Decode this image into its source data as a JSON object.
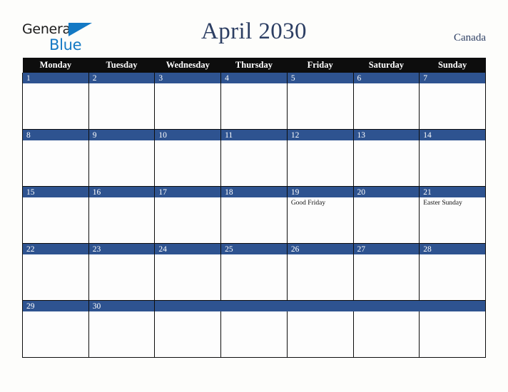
{
  "brand": {
    "name_part1": "General",
    "name_part2": "Blue",
    "triangle_icon": "triangle-icon",
    "color_primary": "#1479c4",
    "color_text": "#1b1b1b"
  },
  "header": {
    "title": "April 2030",
    "region": "Canada",
    "title_color": "#2c3e63"
  },
  "calendar": {
    "weekday_headers": [
      "Monday",
      "Tuesday",
      "Wednesday",
      "Thursday",
      "Friday",
      "Saturday",
      "Sunday"
    ],
    "header_bg": "#0d0d0d",
    "date_band_bg": "#2e5390",
    "cell_bg": "#fdfdfd",
    "weeks": [
      {
        "days": [
          {
            "date": "1",
            "events": []
          },
          {
            "date": "2",
            "events": []
          },
          {
            "date": "3",
            "events": []
          },
          {
            "date": "4",
            "events": []
          },
          {
            "date": "5",
            "events": []
          },
          {
            "date": "6",
            "events": []
          },
          {
            "date": "7",
            "events": []
          }
        ]
      },
      {
        "days": [
          {
            "date": "8",
            "events": []
          },
          {
            "date": "9",
            "events": []
          },
          {
            "date": "10",
            "events": []
          },
          {
            "date": "11",
            "events": []
          },
          {
            "date": "12",
            "events": []
          },
          {
            "date": "13",
            "events": []
          },
          {
            "date": "14",
            "events": []
          }
        ]
      },
      {
        "days": [
          {
            "date": "15",
            "events": []
          },
          {
            "date": "16",
            "events": []
          },
          {
            "date": "17",
            "events": []
          },
          {
            "date": "18",
            "events": []
          },
          {
            "date": "19",
            "events": [
              "Good Friday"
            ]
          },
          {
            "date": "20",
            "events": []
          },
          {
            "date": "21",
            "events": [
              "Easter Sunday"
            ]
          }
        ]
      },
      {
        "days": [
          {
            "date": "22",
            "events": []
          },
          {
            "date": "23",
            "events": []
          },
          {
            "date": "24",
            "events": []
          },
          {
            "date": "25",
            "events": []
          },
          {
            "date": "26",
            "events": []
          },
          {
            "date": "27",
            "events": []
          },
          {
            "date": "28",
            "events": []
          }
        ]
      },
      {
        "days": [
          {
            "date": "29",
            "events": []
          },
          {
            "date": "30",
            "events": []
          },
          {
            "date": "",
            "events": []
          },
          {
            "date": "",
            "events": []
          },
          {
            "date": "",
            "events": []
          },
          {
            "date": "",
            "events": []
          },
          {
            "date": "",
            "events": []
          }
        ]
      }
    ]
  }
}
